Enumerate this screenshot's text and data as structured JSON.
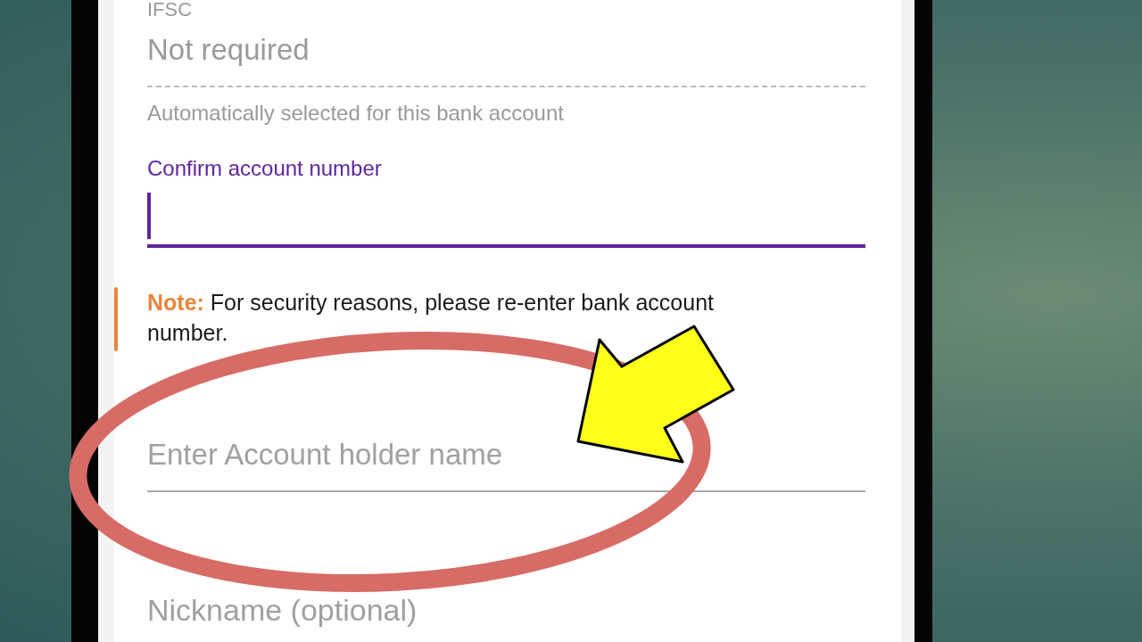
{
  "ifsc_field": {
    "label": "IFSC",
    "value": "Not required",
    "helper": "Automatically selected for this bank account"
  },
  "confirm_account_field": {
    "label": "Confirm account number",
    "focused": true
  },
  "note": {
    "label": "Note:",
    "text": "For security reasons, please re-enter bank account number."
  },
  "account_holder_field": {
    "placeholder": "Enter Account holder name",
    "focused": false
  },
  "nickname_field": {
    "placeholder": "Nickname (optional)"
  }
}
